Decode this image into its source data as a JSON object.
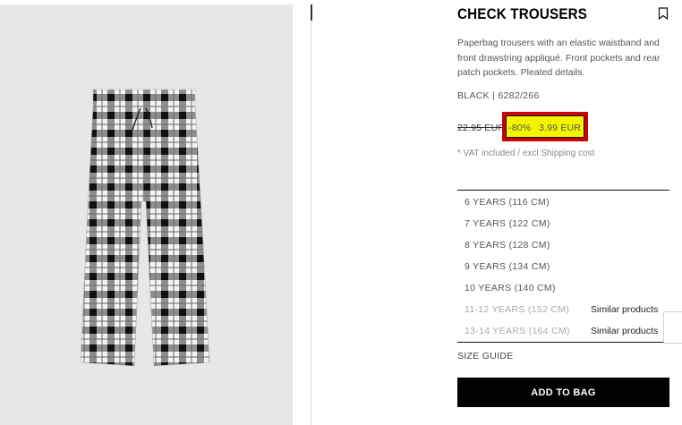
{
  "product": {
    "title": "CHECK TROUSERS",
    "description": "Paperbag trousers with an elastic waistband and front drawstring appliqué. Front pockets and rear patch pockets. Pleated details.",
    "color_ref": "BLACK | 6282/266",
    "old_price": "22.95 EUR",
    "discount": "-80%",
    "new_price": "3.99 EUR",
    "vat_note": "* VAT included / excl Shipping cost",
    "image_alt": "Black and white check trousers"
  },
  "sizes": [
    {
      "label": "6 YEARS (116 CM)",
      "available": true,
      "similar": ""
    },
    {
      "label": "7 YEARS (122 CM)",
      "available": true,
      "similar": ""
    },
    {
      "label": "8 YEARS (128 CM)",
      "available": true,
      "similar": ""
    },
    {
      "label": "9 YEARS (134 CM)",
      "available": true,
      "similar": ""
    },
    {
      "label": "10 YEARS (140 CM)",
      "available": true,
      "similar": ""
    },
    {
      "label": "11-12 YEARS (152 CM)",
      "available": false,
      "similar": "Similar products"
    },
    {
      "label": "13-14 YEARS (164 CM)",
      "available": false,
      "similar": "Similar products"
    }
  ],
  "actions": {
    "size_guide": "SIZE GUIDE",
    "add_to_bag": "ADD TO BAG"
  },
  "icons": {
    "bookmark": "bookmark-icon"
  },
  "colors": {
    "highlight_fill": "#f3f500",
    "highlight_border": "#c80000",
    "button_bg": "#000000"
  }
}
